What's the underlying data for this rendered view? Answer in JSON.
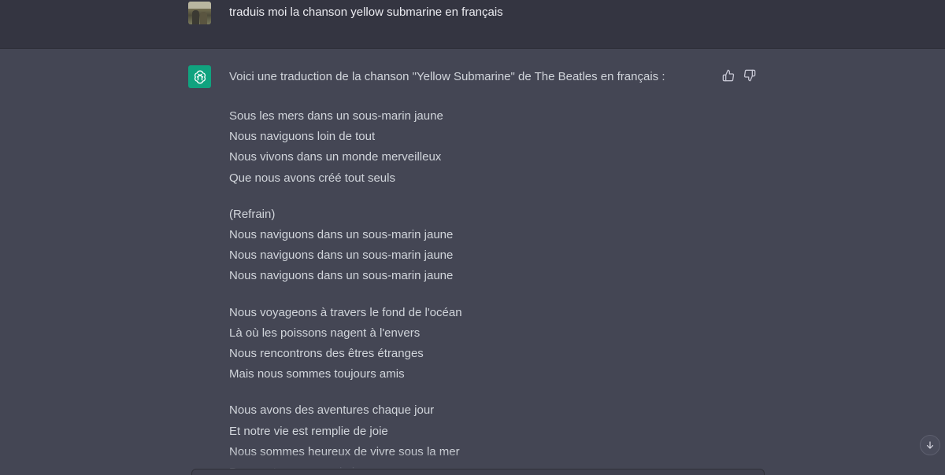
{
  "user_message": {
    "avatar": "user-photo-avatar",
    "text": "traduis moi la chanson yellow submarine en français"
  },
  "assistant_message": {
    "avatar": "openai-logo-icon",
    "intro": "Voici une traduction de la chanson \"Yellow Submarine\" de The Beatles en français :",
    "stanzas": [
      {
        "lines": [
          "Sous les mers dans un sous-marin jaune",
          "Nous naviguons loin de tout",
          "Nous vivons dans un monde merveilleux",
          "Que nous avons créé tout seuls"
        ]
      },
      {
        "lines": [
          "(Refrain)",
          "Nous naviguons dans un sous-marin jaune",
          "Nous naviguons dans un sous-marin jaune",
          "Nous naviguons dans un sous-marin jaune"
        ]
      },
      {
        "lines": [
          "Nous voyageons à travers le fond de l'océan",
          "Là où les poissons nagent à l'envers",
          "Nous rencontrons des êtres étranges",
          "Mais nous sommes toujours amis"
        ]
      },
      {
        "lines": [
          "Nous avons des aventures chaque jour",
          "Et notre vie est remplie de joie",
          "Nous sommes heureux de vivre sous la mer",
          "Dans notre sous-marin jaune"
        ]
      }
    ]
  },
  "icons": {
    "thumbs_up": "thumbs-up-icon",
    "thumbs_down": "thumbs-down-icon",
    "scroll_down": "arrow-down-icon"
  },
  "colors": {
    "user_row_bg": "#343541",
    "assistant_row_bg": "#444654",
    "accent": "#10a37f",
    "text": "#d1d5db"
  }
}
